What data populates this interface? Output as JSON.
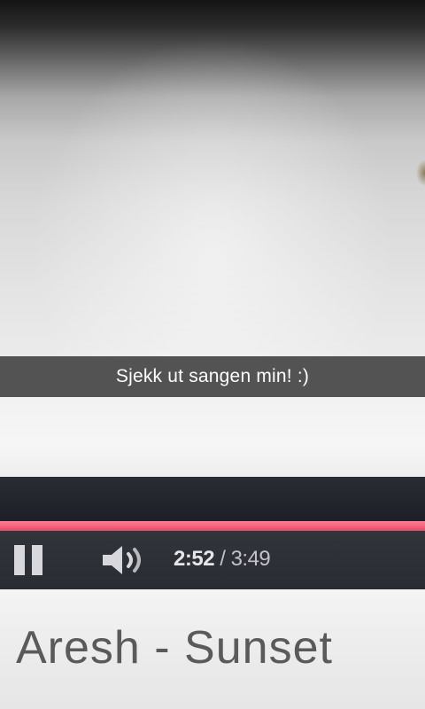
{
  "snap": {
    "caption": "Sjekk ut sangen min! :)"
  },
  "player": {
    "current_time": "2:52",
    "separator": "/",
    "duration": "3:49",
    "progress_fraction": 1.0,
    "accent_color": "#e44a68",
    "pause_icon": "pause-icon",
    "volume_icon": "volume-icon"
  },
  "video": {
    "title": "Aresh - Sunset"
  }
}
